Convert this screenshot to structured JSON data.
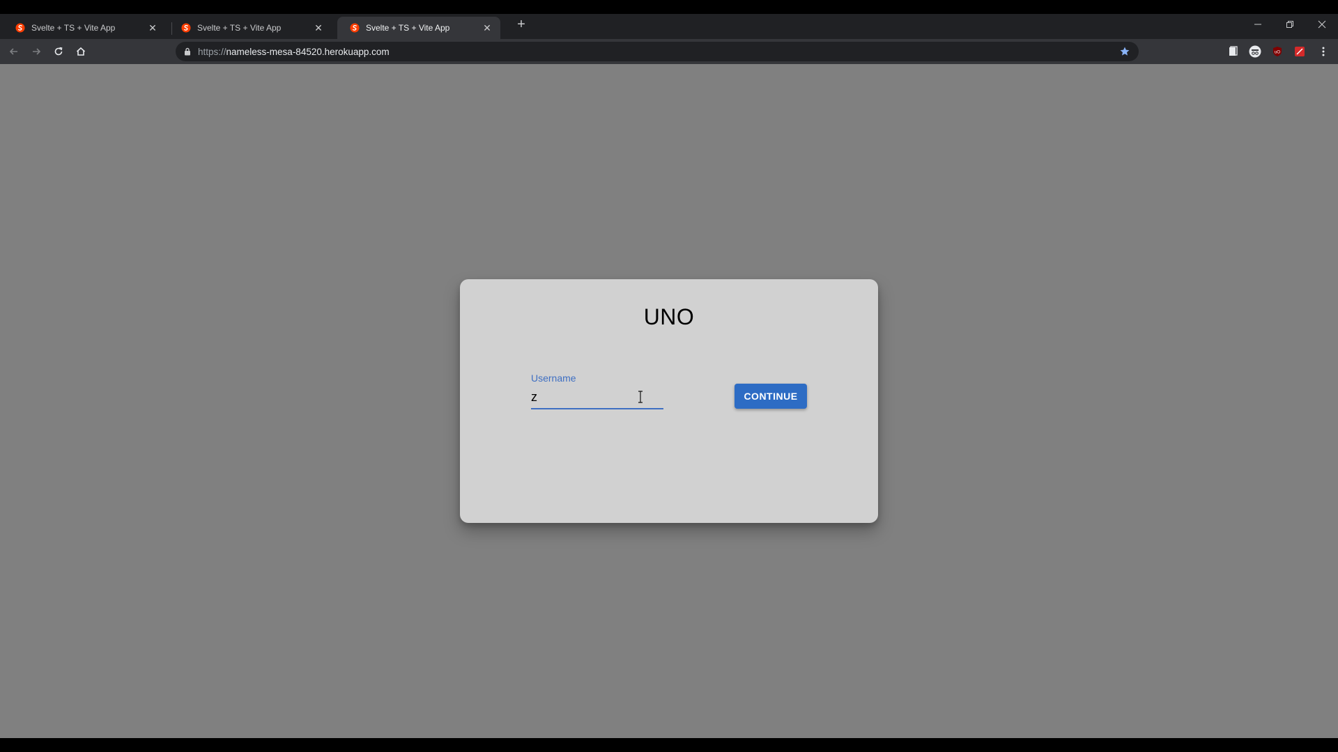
{
  "browser": {
    "tabs": [
      {
        "title": "Svelte + TS + Vite App",
        "active": false
      },
      {
        "title": "Svelte + TS + Vite App",
        "active": false
      },
      {
        "title": "Svelte + TS + Vite App",
        "active": true
      }
    ],
    "url_scheme": "https://",
    "url_host": "nameless-mesa-84520.herokuapp.com",
    "bookmarked": true,
    "colors": {
      "tabstrip": "#202124",
      "toolbar": "#35363a",
      "favicon": "#ff3e00",
      "star": "#8ab4f8"
    }
  },
  "page": {
    "title": "UNO",
    "username_label": "Username",
    "username_value": "z",
    "continue_label": "CONTINUE",
    "colors": {
      "background": "#808080",
      "card": "#d1d1d1",
      "accent": "#3f6fc2",
      "button": "#2d6cc4"
    }
  }
}
